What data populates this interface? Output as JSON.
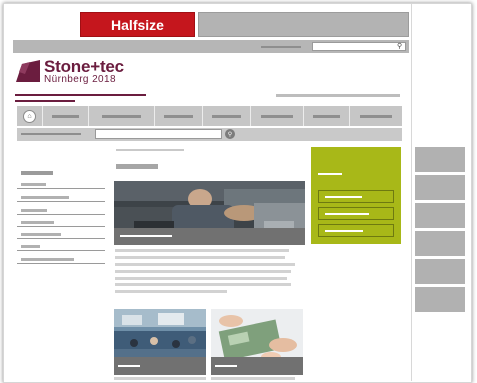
{
  "header": {
    "halfsize_label": "Halfsize"
  },
  "brand": {
    "name": "Stone+tec",
    "subtitle": "Nürnberg 2018",
    "color": "#6b1d3f"
  },
  "colors": {
    "accent_red": "#c5161d",
    "accent_green": "#a8b818"
  },
  "icons": {
    "home": "home-icon",
    "search": "magnifier-icon"
  }
}
